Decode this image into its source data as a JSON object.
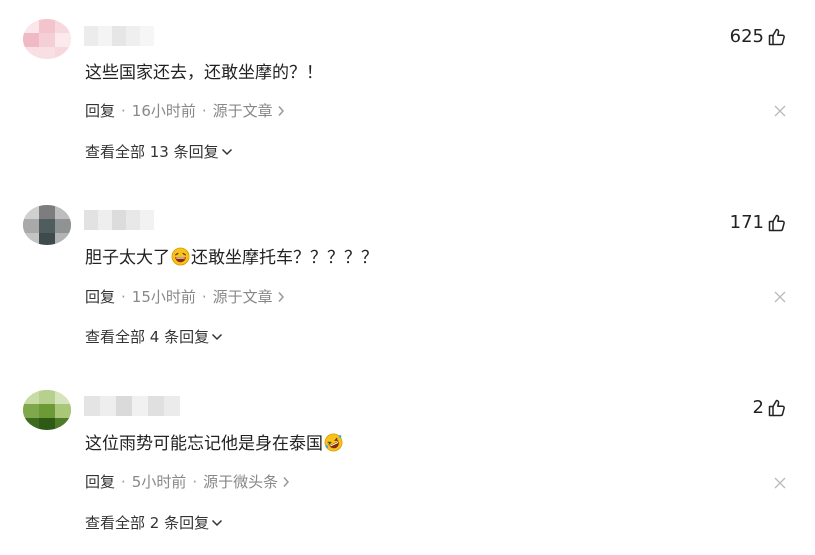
{
  "comments": [
    {
      "text": "这些国家还去，还敢坐摩的？！",
      "likes": "625",
      "reply_label": "回复",
      "time": "16小时前",
      "source": "源于文章",
      "view_all": "查看全部 13 条回复"
    },
    {
      "text_before": "胆子太大了",
      "emoji": "laughing-emoji",
      "text_after": "还敢坐摩托车？？？？？",
      "likes": "171",
      "reply_label": "回复",
      "time": "15小时前",
      "source": "源于文章",
      "view_all": "查看全部 4 条回复"
    },
    {
      "text_before": "这位雨势可能忘记他是身在泰国",
      "emoji": "rofl-emoji",
      "likes": "2",
      "reply_label": "回复",
      "time": "5小时前",
      "source": "源于微头条",
      "view_all": "查看全部 2 条回复"
    }
  ],
  "colors": {
    "text": "#222222",
    "meta": "#888888",
    "mosaic_light": "#f0f0f0",
    "mosaic_dark": "#d8d8d8"
  },
  "icons": [
    "thumbs-up-icon",
    "close-icon",
    "chevron-right-icon",
    "chevron-down-icon"
  ]
}
